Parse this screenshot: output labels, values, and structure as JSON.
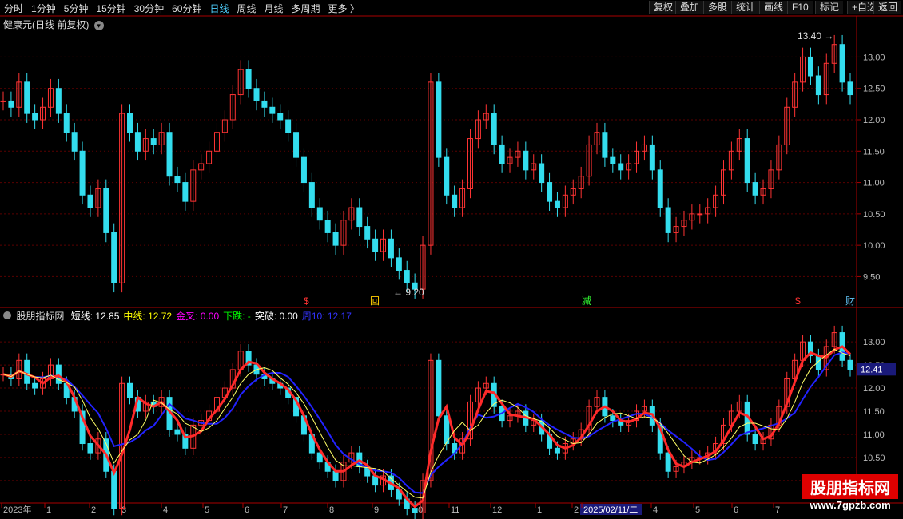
{
  "toolbar": {
    "periods": [
      "分时",
      "1分钟",
      "5分钟",
      "15分钟",
      "30分钟",
      "60分钟",
      "日线",
      "周线",
      "月线",
      "多周期",
      "更多"
    ],
    "active_period": "日线",
    "buttons": [
      "复权",
      "叠加",
      "多股",
      "统计",
      "画线",
      "F10",
      "+自选",
      "返回"
    ],
    "mark_label": "标记"
  },
  "main_panel": {
    "title": "健康元(日线 前复权)",
    "high_label": "13.40",
    "low_label": "9.20",
    "markers": [
      "$",
      "回",
      "减",
      "$",
      "财"
    ]
  },
  "indicator_panel": {
    "name": "股朋指标网",
    "items": [
      {
        "label": "短线:",
        "value": "12.85",
        "color": "#ffffff"
      },
      {
        "label": "中线:",
        "value": "12.72",
        "color": "#ffff00"
      },
      {
        "label": "金叉:",
        "value": "0.00",
        "color": "#ff00ff"
      },
      {
        "label": "下跌:",
        "value": "-",
        "color": "#00ff00"
      },
      {
        "label": "突破:",
        "value": "0.00",
        "color": "#ffffff"
      },
      {
        "label": "周10:",
        "value": "12.17",
        "color": "#3333ff"
      }
    ],
    "current_price_label": "12.41"
  },
  "chart_data": {
    "type": "candlestick",
    "upper_y_ticks": [
      "13.00",
      "12.50",
      "12.00",
      "11.50",
      "11.00",
      "10.50",
      "10.00",
      "9.50"
    ],
    "lower_y_ticks": [
      "13.00",
      "12.50",
      "12.00",
      "11.50",
      "11.00",
      "10.50",
      "10.00"
    ],
    "upper_ylim": [
      9.2,
      13.4
    ],
    "lower_ylim": [
      9.6,
      13.4
    ],
    "x_labels": [
      "2023年",
      "1",
      "2",
      "3",
      "4",
      "5",
      "6",
      "7",
      "8",
      "9",
      "10",
      "11",
      "12",
      "1",
      "2",
      "2025/02/11/二",
      "4",
      "5",
      "6",
      "7"
    ],
    "highlighted_date": "2025/02/11/二",
    "close_series": [
      12.3,
      12.2,
      12.6,
      12.1,
      12.0,
      12.2,
      12.5,
      12.1,
      11.8,
      11.5,
      10.8,
      10.6,
      10.9,
      10.2,
      9.4,
      12.1,
      11.8,
      11.5,
      11.7,
      11.6,
      11.8,
      11.1,
      11.0,
      10.7,
      11.2,
      11.3,
      11.5,
      11.8,
      12.0,
      12.4,
      12.8,
      12.5,
      12.3,
      12.2,
      12.1,
      12.0,
      11.8,
      11.4,
      11.0,
      10.6,
      10.4,
      10.2,
      10.0,
      10.4,
      10.6,
      10.3,
      10.1,
      9.9,
      10.1,
      9.8,
      9.6,
      9.4,
      9.3,
      10.0,
      12.6,
      11.4,
      10.8,
      10.6,
      10.9,
      11.7,
      12.0,
      12.1,
      11.6,
      11.3,
      11.4,
      11.5,
      11.2,
      11.3,
      11.0,
      10.7,
      10.6,
      10.8,
      10.9,
      11.1,
      11.6,
      11.8,
      11.4,
      11.3,
      11.2,
      11.3,
      11.5,
      11.6,
      11.2,
      10.6,
      10.2,
      10.3,
      10.4,
      10.5,
      10.5,
      10.6,
      10.8,
      11.2,
      11.5,
      11.7,
      11.0,
      10.8,
      10.9,
      11.2,
      11.6,
      12.2,
      12.6,
      13.0,
      12.7,
      12.4,
      12.9,
      13.2,
      12.6,
      12.4
    ]
  }
}
